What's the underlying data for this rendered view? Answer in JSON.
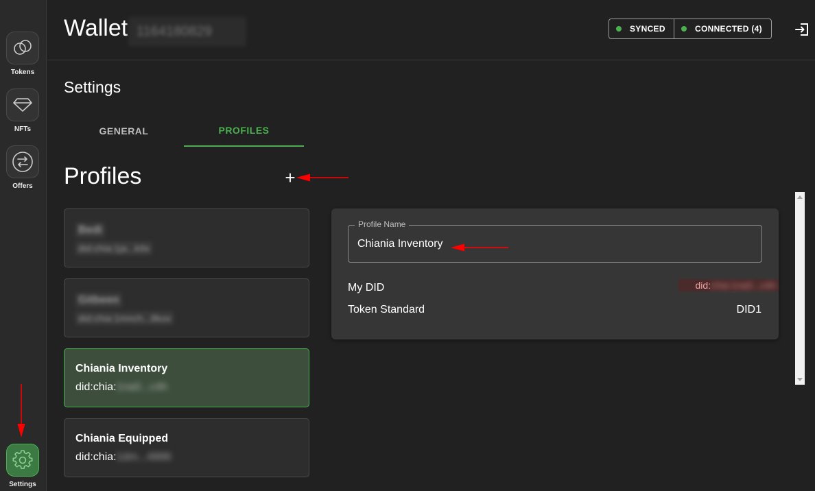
{
  "sidebar": {
    "items": [
      {
        "label": "Tokens",
        "icon": "tokens-icon"
      },
      {
        "label": "NFTs",
        "icon": "diamond-icon"
      },
      {
        "label": "Offers",
        "icon": "swap-icon"
      },
      {
        "label": "Settings",
        "icon": "gear-icon",
        "active": true
      }
    ]
  },
  "header": {
    "title": "Wallet",
    "fingerprint": "1164180829",
    "status": [
      {
        "label": "SYNCED",
        "color": "#4caf50"
      },
      {
        "label": "CONNECTED (4)",
        "color": "#4caf50"
      }
    ],
    "logout_icon": "logout-icon"
  },
  "settings": {
    "title": "Settings",
    "tabs": [
      {
        "label": "GENERAL",
        "active": false
      },
      {
        "label": "PROFILES",
        "active": true
      }
    ]
  },
  "profiles": {
    "title": "Profiles",
    "add_label": "+",
    "items": [
      {
        "name": "Bedi",
        "did_prefix": "",
        "did_rest": "did:chia:1ja...k9x",
        "blurred": true
      },
      {
        "name": "Gitbeen",
        "did_prefix": "",
        "did_rest": "did:chia:1mnch...8kov",
        "blurred": true
      },
      {
        "name": "Chiania Inventory",
        "did_prefix": "did:chia:",
        "did_rest": "1na0...c4h",
        "selected": true
      },
      {
        "name": "Chiania Equipped",
        "did_prefix": "did:chia:",
        "did_rest": "1dm...4886"
      }
    ]
  },
  "detail": {
    "field_label": "Profile Name",
    "field_value": "Chiania Inventory",
    "rows": [
      {
        "label": "My DID",
        "value_prefix": "did:",
        "value_rest": "chia:1na0...c4h"
      },
      {
        "label": "Token Standard",
        "value": "DID1"
      }
    ]
  },
  "colors": {
    "accent": "#4caf50",
    "annotation": "#ff0000"
  }
}
